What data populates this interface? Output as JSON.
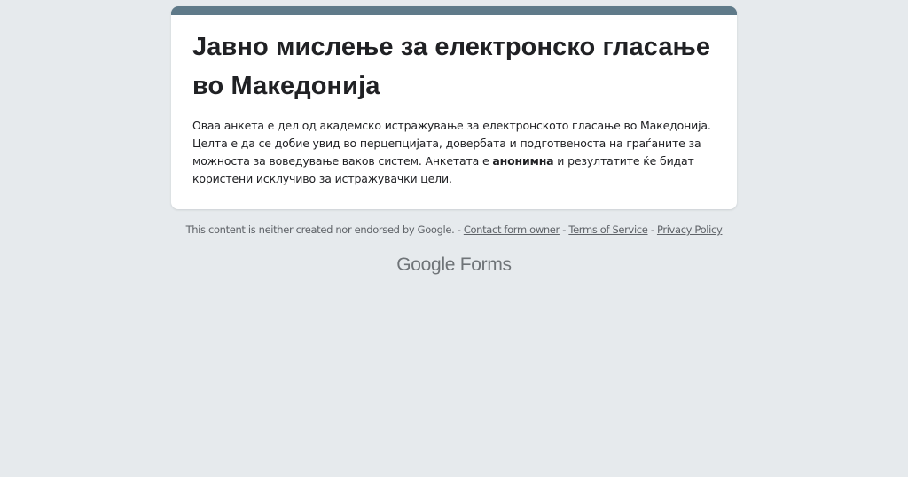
{
  "form": {
    "accent_color": "#5f7a89",
    "title": "Јавно мислење за електронско гласање во Македонија",
    "description": {
      "part1": "Оваа анкета е дел од академско истражување за електронското гласање во Македонија. Целта е да се добие увид во перцепцијата, довербата и подготвеноста на граѓаните за можноста за воведување ваков систем. Анкетата е ",
      "bold": "анонимна",
      "part2": " и резултатите ќе бидат користени исклучиво за истражувачки цели."
    }
  },
  "footer": {
    "disclaimer": "This content is neither created nor endorsed by Google. - ",
    "contact_link": "Contact form owner",
    "sep1": " - ",
    "terms_link": "Terms of Service",
    "sep2": " - ",
    "privacy_link": "Privacy Policy"
  },
  "branding": {
    "google": "Google",
    "forms": "Forms"
  }
}
